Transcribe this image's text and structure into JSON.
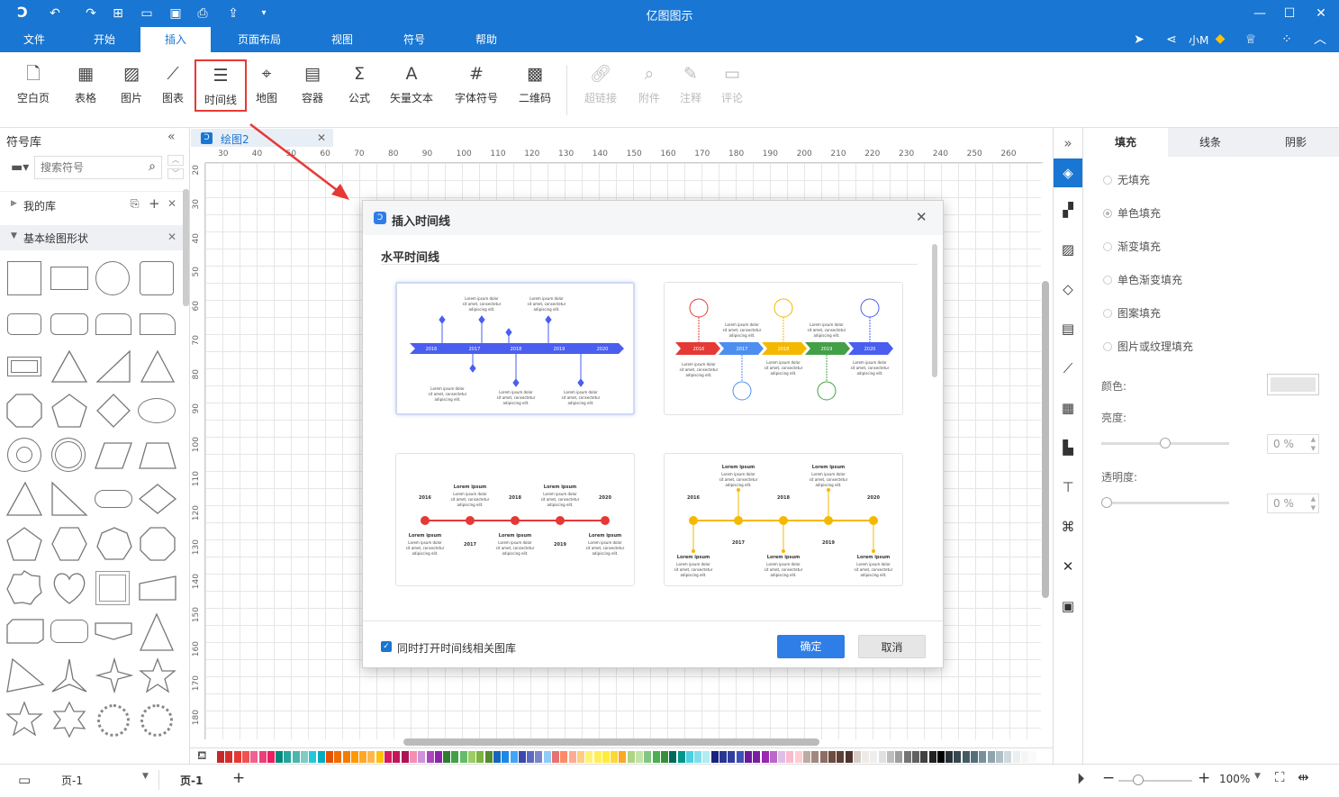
{
  "app": {
    "title": "亿图图示"
  },
  "menu": {
    "items": [
      "文件",
      "开始",
      "插入",
      "页面布局",
      "视图",
      "符号",
      "帮助"
    ],
    "active": "插入",
    "user": "小M"
  },
  "ribbon": {
    "buttons": [
      {
        "label": "空白页",
        "icon": "blank-page-icon"
      },
      {
        "label": "表格",
        "icon": "table-icon"
      },
      {
        "label": "图片",
        "icon": "image-icon"
      },
      {
        "label": "图表",
        "icon": "chart-icon"
      },
      {
        "label": "时间线",
        "icon": "timeline-icon"
      },
      {
        "label": "地图",
        "icon": "map-pin-icon"
      },
      {
        "label": "容器",
        "icon": "container-icon"
      },
      {
        "label": "公式",
        "icon": "sigma-icon"
      },
      {
        "label": "矢量文本",
        "icon": "vector-text-icon"
      },
      {
        "label": "字体符号",
        "icon": "hash-icon"
      },
      {
        "label": "二维码",
        "icon": "qrcode-icon"
      },
      {
        "label": "超链接",
        "icon": "link-icon"
      },
      {
        "label": "附件",
        "icon": "paperclip-icon"
      },
      {
        "label": "注释",
        "icon": "pen-icon"
      },
      {
        "label": "评论",
        "icon": "comment-icon"
      }
    ],
    "highlight_color": "#e53935"
  },
  "left": {
    "title": "符号库",
    "search_placeholder": "搜索符号",
    "my_lib": "我的库",
    "basic_shapes": "基本绘图形状"
  },
  "doc_tab": {
    "label": "绘图2"
  },
  "ruler": {
    "top": [
      "30",
      "40",
      "50",
      "60",
      "70",
      "80",
      "90",
      "100",
      "110",
      "120",
      "130",
      "140",
      "150",
      "160",
      "170",
      "180",
      "190",
      "200",
      "210",
      "220",
      "230",
      "240",
      "250",
      "260"
    ],
    "left": [
      "20",
      "30",
      "40",
      "50",
      "60",
      "70",
      "80",
      "90",
      "100",
      "110",
      "120",
      "130",
      "140",
      "150",
      "160",
      "170",
      "180"
    ]
  },
  "dialog": {
    "title": "插入时间线",
    "section": "水平时间线",
    "checkbox_label": "同时打开时间线相关图库",
    "ok": "确定",
    "cancel": "取消",
    "cards": [
      {
        "years": [
          "2016",
          "2017",
          "2018",
          "2019",
          "2020"
        ]
      },
      {
        "years": [
          "2016",
          "2017",
          "2018",
          "2019",
          "2020"
        ]
      },
      {
        "years": [
          "2016",
          "2017",
          "2018",
          "2019",
          "2020"
        ]
      },
      {
        "years": [
          "2016",
          "2017",
          "2018",
          "2019",
          "2020"
        ]
      }
    ],
    "lorem_title": "Lorem ipsum",
    "lorem_body": "Lorem ipsum dolor sit amet, consectetur adipiscing elit."
  },
  "right": {
    "tabs": [
      "填充",
      "线条",
      "阴影"
    ],
    "active_tab": "填充",
    "options": [
      "无填充",
      "单色填充",
      "渐变填充",
      "单色渐变填充",
      "图案填充",
      "图片或纹理填充"
    ],
    "selected_option": "单色填充",
    "color_label": "颜色:",
    "brightness_label": "亮度:",
    "brightness_value": "0 %",
    "opacity_label": "透明度:",
    "opacity_value": "0 %"
  },
  "status": {
    "page_select": "页-1",
    "page_tab": "页-1",
    "zoom": "100%"
  },
  "colors": {
    "brand": "#1976d2",
    "accent": "#2f7ee7",
    "timeline_blue": "#4a5ef0",
    "timeline_red": "#e53935",
    "timeline_yellow": "#f5b800"
  }
}
